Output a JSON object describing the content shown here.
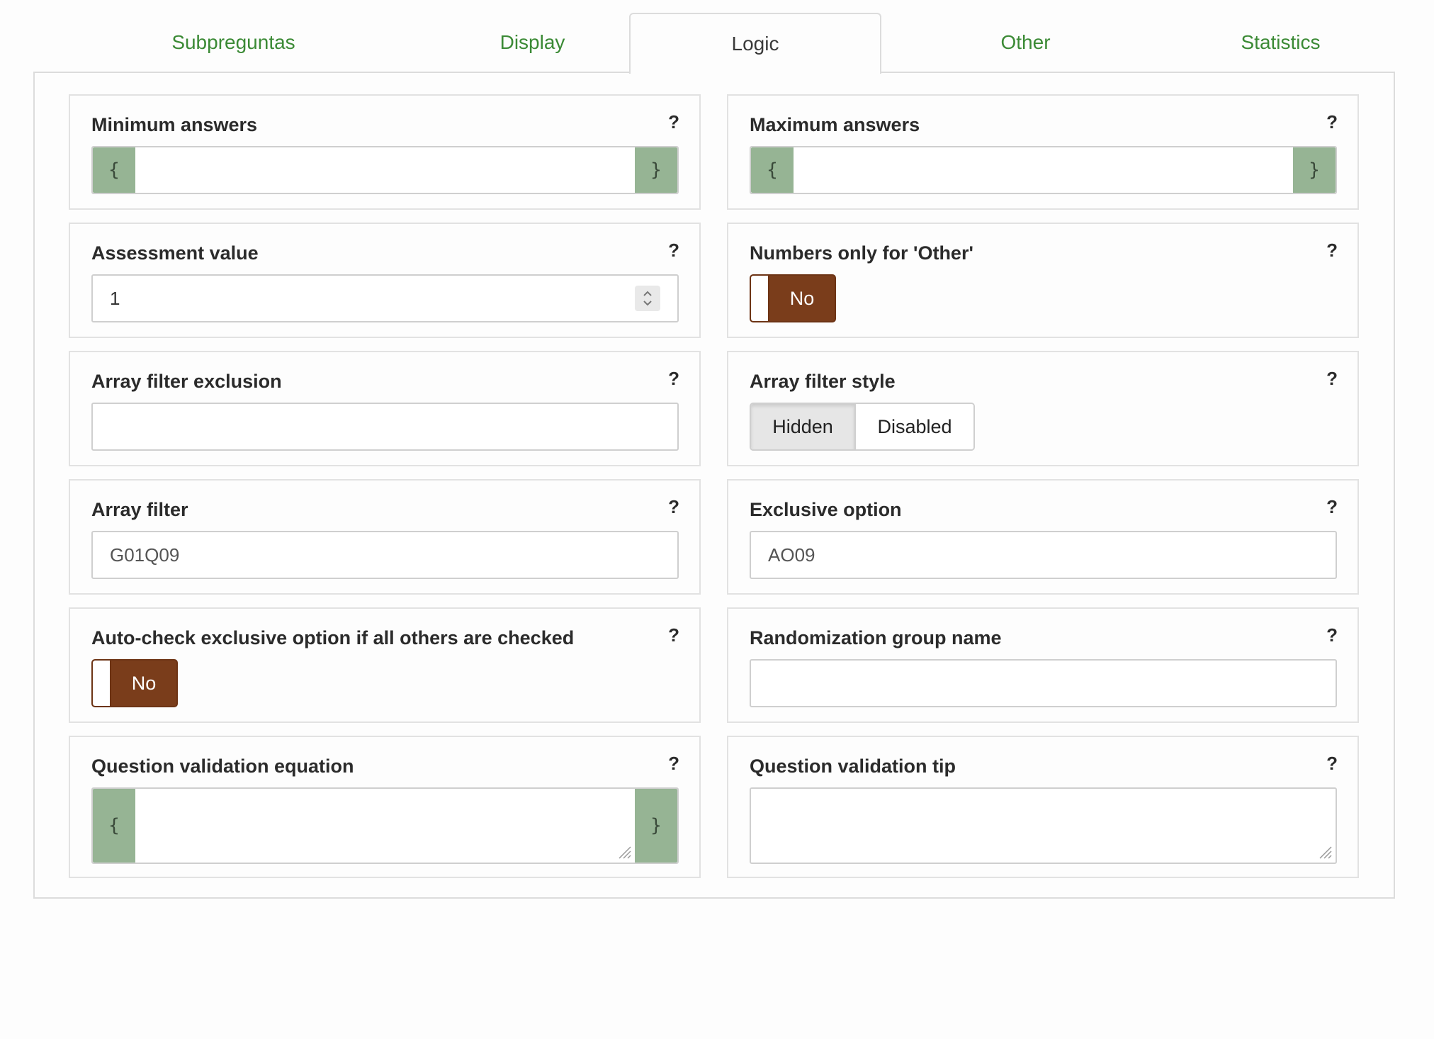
{
  "tabs": [
    {
      "label": "Subpreguntas"
    },
    {
      "label": "Display"
    },
    {
      "label": "Logic"
    },
    {
      "label": "Other"
    },
    {
      "label": "Statistics"
    }
  ],
  "active_tab": "Logic",
  "help_label": "?",
  "brace_open": "{",
  "brace_close": "}",
  "fields": {
    "min_answers": {
      "label": "Minimum answers",
      "value": ""
    },
    "max_answers": {
      "label": "Maximum answers",
      "value": ""
    },
    "assessment_value": {
      "label": "Assessment value",
      "value": "1"
    },
    "numbers_only_other": {
      "label": "Numbers only for 'Other'",
      "toggle": "No"
    },
    "array_filter_exclusion": {
      "label": "Array filter exclusion",
      "value": ""
    },
    "array_filter_style": {
      "label": "Array filter style",
      "options": [
        "Hidden",
        "Disabled"
      ],
      "selected": "Hidden"
    },
    "array_filter": {
      "label": "Array filter",
      "placeholder": "G01Q09"
    },
    "exclusive_option": {
      "label": "Exclusive option",
      "placeholder": "AO09"
    },
    "auto_check_exclusive": {
      "label": "Auto-check exclusive option if all others are checked",
      "toggle": "No"
    },
    "randomization_group": {
      "label": "Randomization group name",
      "value": ""
    },
    "validation_equation": {
      "label": "Question validation equation",
      "value": ""
    },
    "validation_tip": {
      "label": "Question validation tip",
      "value": ""
    }
  },
  "colors": {
    "tab_link": "#3b8a35",
    "brace_bg": "#96b494",
    "toggle_bg": "#7a3d1b"
  }
}
